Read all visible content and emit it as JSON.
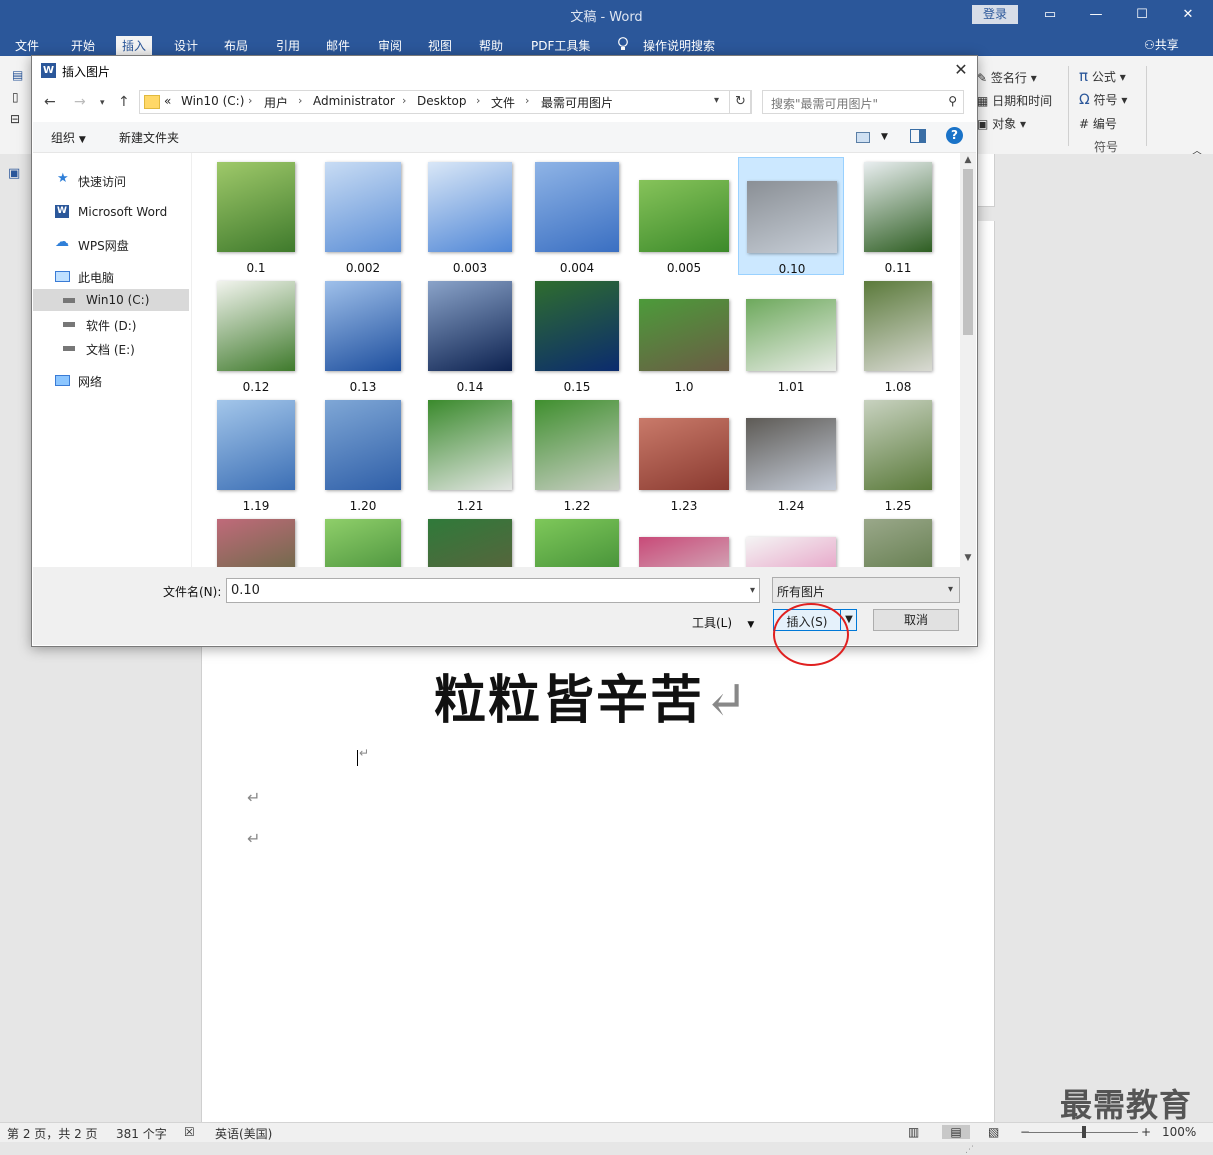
{
  "app": {
    "title": "文稿  -  Word",
    "login_label": "登录",
    "share_label": "共享",
    "menu_tabs": [
      "文件",
      "开始",
      "插入",
      "设计",
      "布局",
      "引用",
      "邮件",
      "审阅",
      "视图",
      "帮助",
      "PDF工具集",
      "操作说明搜索"
    ],
    "active_tab": "插入"
  },
  "ribbon": {
    "items": [
      "签名行",
      "日期和时间",
      "对象",
      "公式",
      "符号",
      "编号"
    ],
    "group_label": "符号"
  },
  "document": {
    "heading": "粒粒皆辛苦",
    "para_mark": "↵"
  },
  "statusbar": {
    "page": "第 2 页，共 2 页",
    "words": "381 个字",
    "language": "英语(美国)",
    "zoom": "100%",
    "zoom_minus": "−",
    "zoom_plus": "+"
  },
  "watermark": "最需教育",
  "dialog": {
    "title": "插入图片",
    "path": [
      "Win10 (C:)",
      "用户",
      "Administrator",
      "Desktop",
      "文件",
      "最需可用图片"
    ],
    "path_prefix": "«",
    "search_placeholder": "搜索\"最需可用图片\"",
    "organize_label": "组织",
    "new_folder_label": "新建文件夹",
    "nav_items": [
      {
        "label": "快速访问",
        "icon": "star-icon"
      },
      {
        "label": "Microsoft Word",
        "icon": "word-icon"
      },
      {
        "label": "WPS网盘",
        "icon": "cloud-icon"
      },
      {
        "label": "此电脑",
        "icon": "computer-icon"
      },
      {
        "label": "Win10 (C:)",
        "icon": "drive-icon"
      },
      {
        "label": "软件 (D:)",
        "icon": "drive-icon"
      },
      {
        "label": "文档 (E:)",
        "icon": "drive-icon"
      },
      {
        "label": "网络",
        "icon": "network-icon"
      }
    ],
    "files": [
      "0.1",
      "0.002",
      "0.003",
      "0.004",
      "0.005",
      "0.10",
      "0.11",
      "0.12",
      "0.13",
      "0.14",
      "0.15",
      "1.0",
      "1.01",
      "1.08",
      "1.19",
      "1.20",
      "1.21",
      "1.22",
      "1.23",
      "1.24",
      "1.25",
      "",
      "",
      "",
      "",
      "",
      "",
      ""
    ],
    "selected_file": "0.10",
    "filename_label": "文件名(N):",
    "filename_value": "0.10",
    "filetype_value": "所有图片",
    "tools_label": "工具(L)",
    "insert_label": "插入(S)",
    "cancel_label": "取消"
  },
  "colors": {
    "word_blue": "#2b579a",
    "selection": "#cce8ff",
    "annotation_red": "#e02020"
  }
}
